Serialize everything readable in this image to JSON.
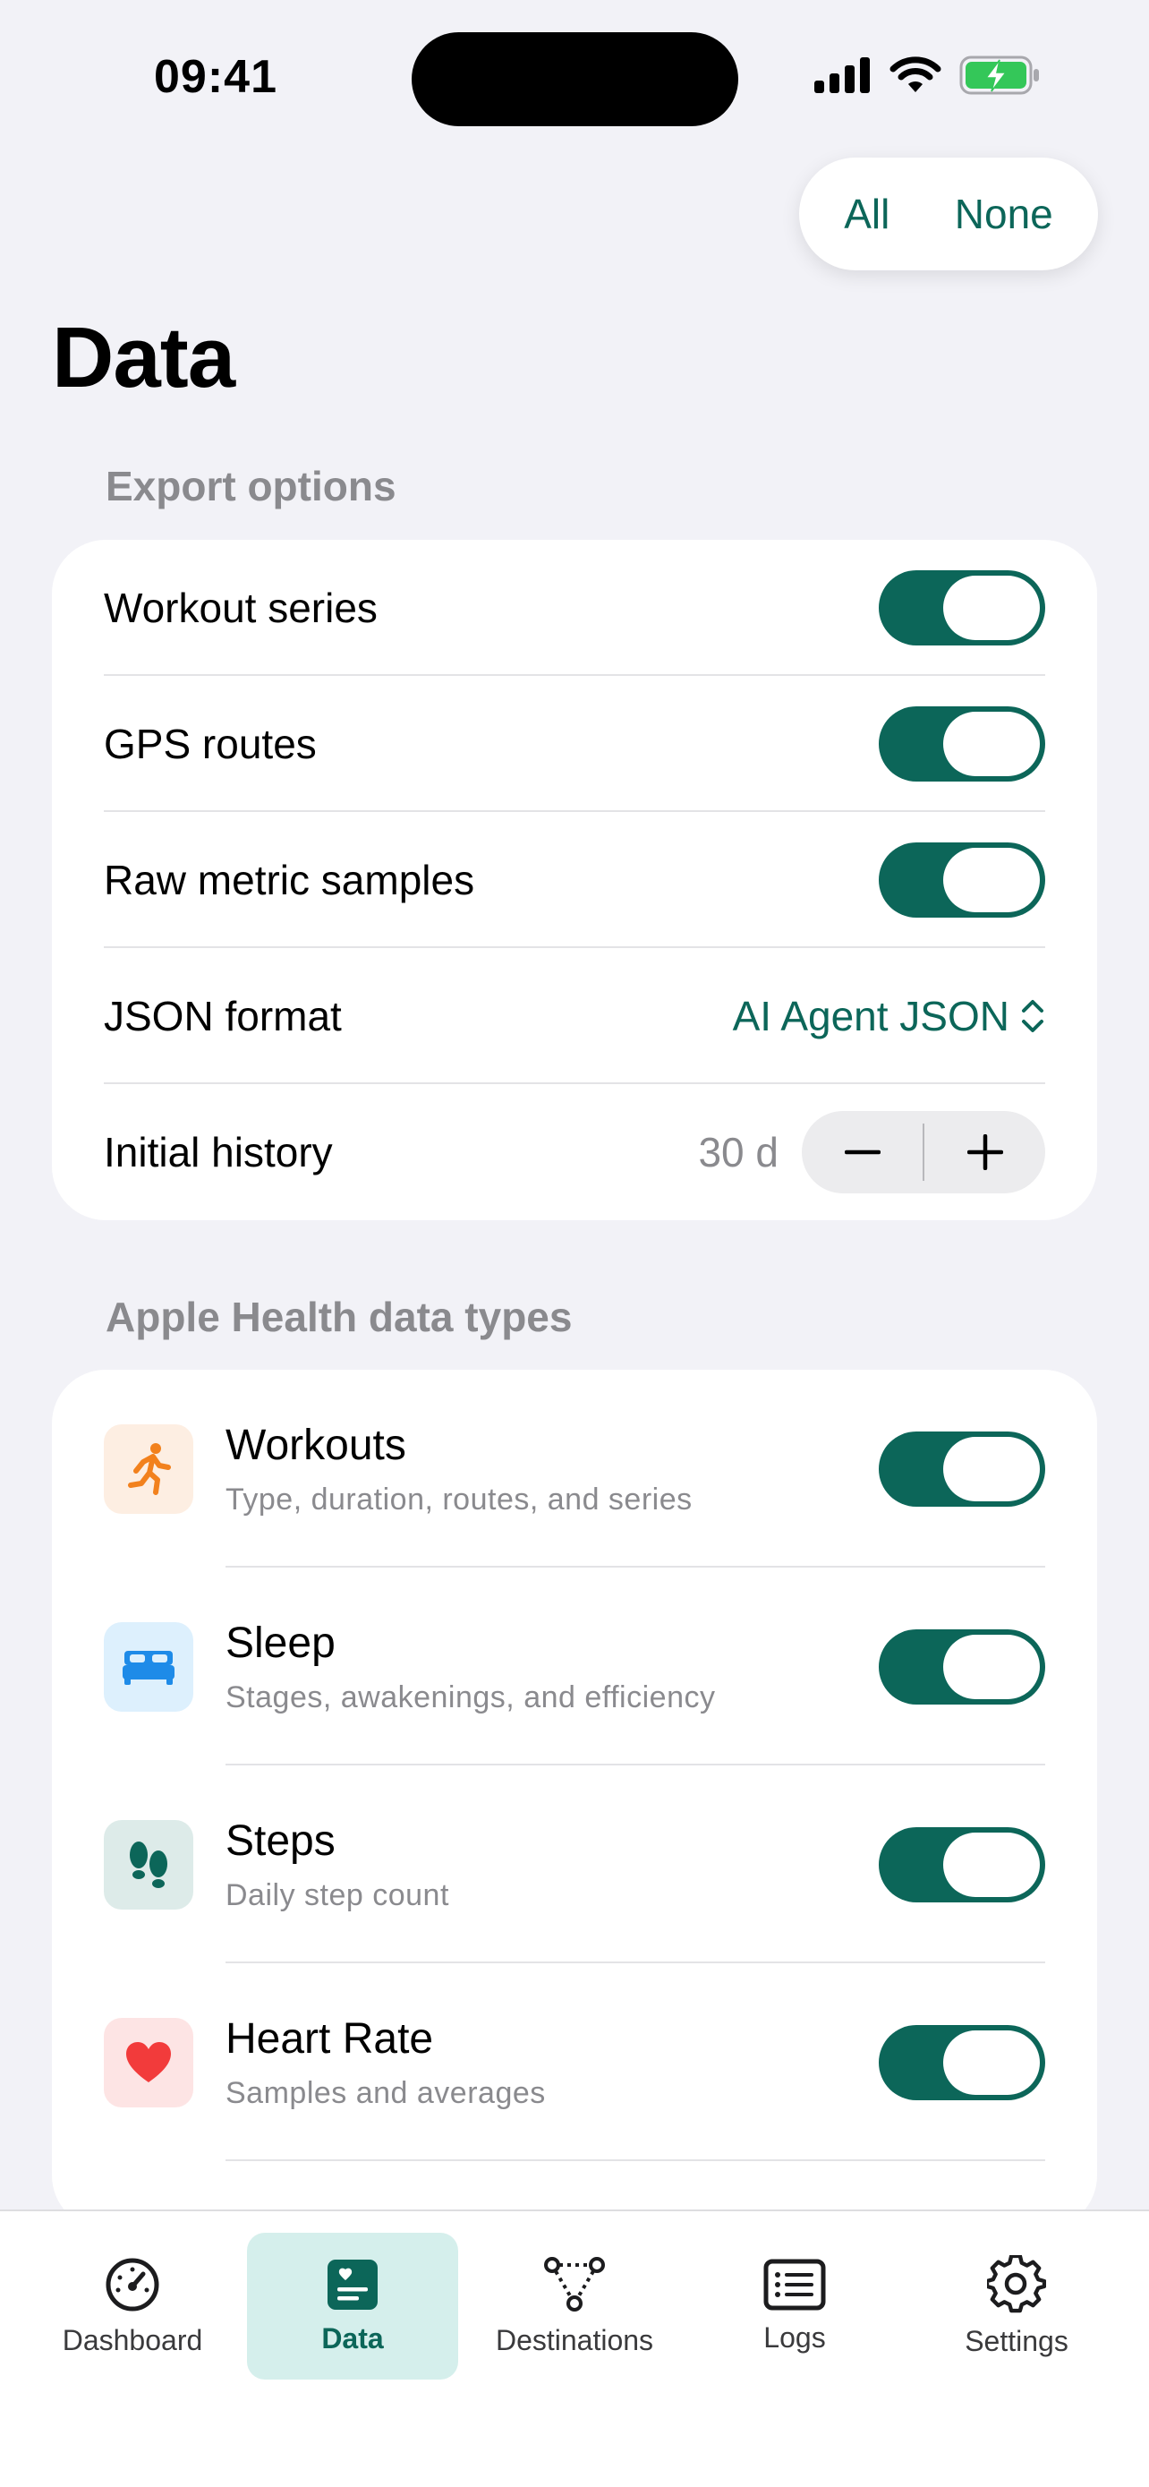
{
  "status_bar": {
    "time": "09:41"
  },
  "selection_pill": {
    "all_label": "All",
    "none_label": "None"
  },
  "page": {
    "title": "Data"
  },
  "export_options": {
    "header": "Export options",
    "workout_series": {
      "label": "Workout series",
      "on": true
    },
    "gps_routes": {
      "label": "GPS routes",
      "on": true
    },
    "raw_metric_samples": {
      "label": "Raw metric samples",
      "on": true
    },
    "json_format": {
      "label": "JSON format",
      "value": "AI Agent JSON"
    },
    "initial_history": {
      "label": "Initial history",
      "value": "30 d",
      "minus": "−",
      "plus": "+"
    }
  },
  "health_types": {
    "header": "Apple Health data types",
    "items": [
      {
        "icon": "running-figure-icon",
        "name": "Workouts",
        "description": "Type, duration, routes, and series",
        "on": true
      },
      {
        "icon": "bed-icon",
        "name": "Sleep",
        "description": "Stages, awakenings, and efficiency",
        "on": true
      },
      {
        "icon": "footprints-icon",
        "name": "Steps",
        "description": "Daily step count",
        "on": true
      },
      {
        "icon": "heart-icon",
        "name": "Heart Rate",
        "description": "Samples and averages",
        "on": true
      }
    ]
  },
  "colors": {
    "accent": "#0C6659",
    "background": "#F2F2F7",
    "active_tab_bg": "#D5EFEC"
  },
  "tabbar": {
    "tabs": [
      {
        "label": "Dashboard",
        "icon": "gauge-icon",
        "active": false
      },
      {
        "label": "Data",
        "icon": "data-card-icon",
        "active": true
      },
      {
        "label": "Destinations",
        "icon": "network-icon",
        "active": false
      },
      {
        "label": "Logs",
        "icon": "list-icon",
        "active": false
      },
      {
        "label": "Settings",
        "icon": "gear-icon",
        "active": false
      }
    ]
  }
}
